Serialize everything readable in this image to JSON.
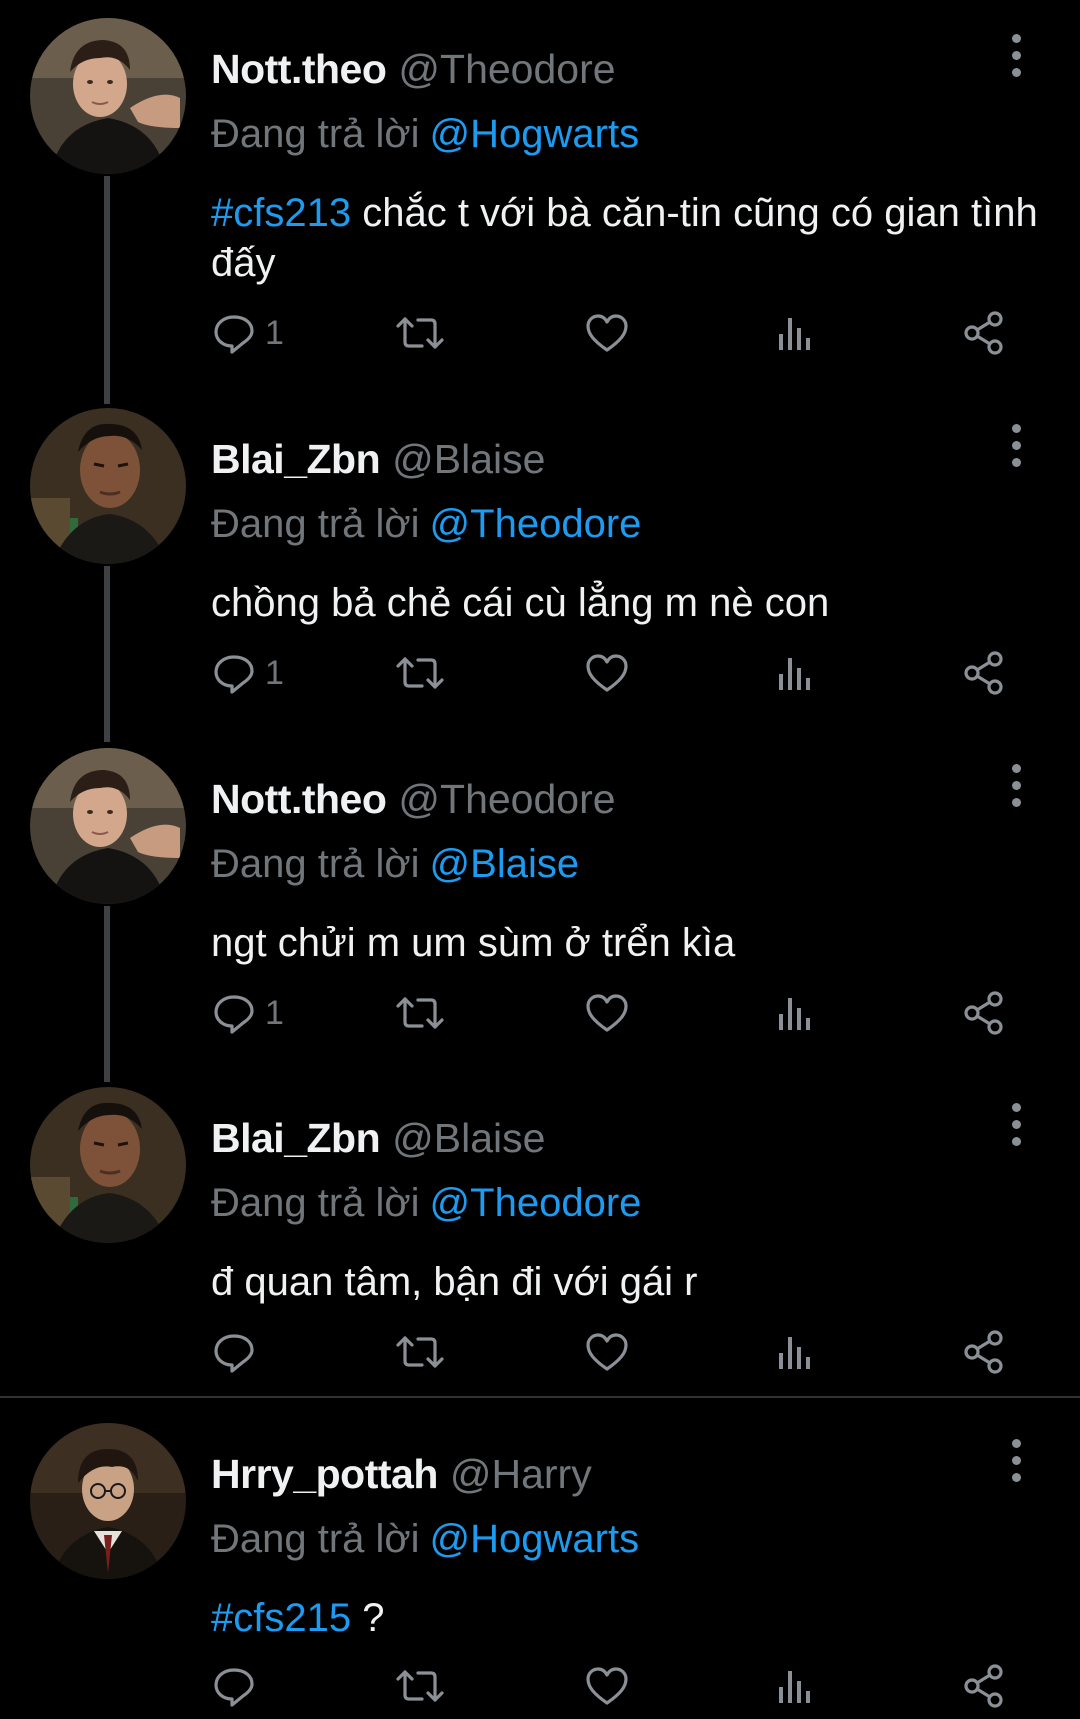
{
  "reply_prefix": "Đang trả lời",
  "tweets": [
    {
      "display_name": "Nott.theo",
      "handle": "@Theodore",
      "reply_to": "@Hogwarts",
      "hashtag": "#cfs213",
      "text": " chắc t với bà căn-tin cũng có gian tình đấy",
      "reply_count": "1",
      "avatar": "theodore"
    },
    {
      "display_name": "Blai_Zbn",
      "handle": "@Blaise",
      "reply_to": "@Theodore",
      "hashtag": "",
      "text": "chồng bả chẻ cái cù lẳng m nè con",
      "reply_count": "1",
      "avatar": "blaise"
    },
    {
      "display_name": "Nott.theo",
      "handle": "@Theodore",
      "reply_to": "@Blaise",
      "hashtag": "",
      "text": "ngt chửi m um sùm ở trển kìa",
      "reply_count": "1",
      "avatar": "theodore"
    },
    {
      "display_name": "Blai_Zbn",
      "handle": "@Blaise",
      "reply_to": "@Theodore",
      "hashtag": "",
      "text": "đ quan tâm, bận đi với gái r",
      "reply_count": "",
      "avatar": "blaise"
    },
    {
      "display_name": "Hrry_pottah",
      "handle": "@Harry",
      "reply_to": "@Hogwarts",
      "hashtag": "#cfs215",
      "text": " ?",
      "reply_count": "",
      "avatar": "harry"
    }
  ],
  "icons": {
    "reply": "reply-bubble-icon",
    "retweet": "retweet-icon",
    "like": "heart-icon",
    "views": "views-bars-icon",
    "share": "share-icon",
    "more": "more-vertical-icon"
  },
  "colors": {
    "background": "#000000",
    "text": "#f0f1f2",
    "muted": "#71767b",
    "link": "#1d9bf0",
    "thread_line": "#3e4144"
  }
}
